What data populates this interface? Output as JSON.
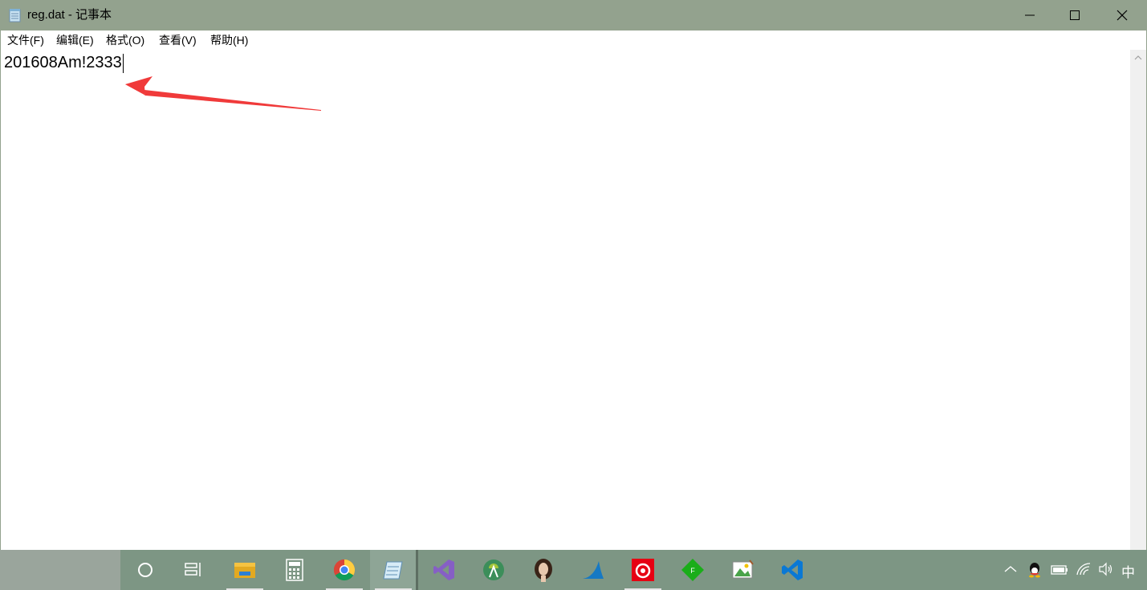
{
  "window": {
    "title": "reg.dat - 记事本",
    "minimize_icon": "minimize-icon",
    "maximize_icon": "maximize-icon",
    "close_icon": "close-icon"
  },
  "menu": {
    "items": [
      {
        "label": "文件(F)"
      },
      {
        "label": "编辑(E)"
      },
      {
        "label": "格式(O)"
      },
      {
        "label": "查看(V)"
      },
      {
        "label": "帮助(H)"
      }
    ]
  },
  "editor": {
    "content": "201608Am!2333"
  },
  "annotation": {
    "color": "#f03a3a"
  },
  "taskbar": {
    "icons": [
      "cortana-icon",
      "task-view-icon",
      "file-explorer-icon",
      "calculator-icon",
      "chrome-icon",
      "notepad-icon",
      "visual-studio-icon",
      "android-studio-icon",
      "portrait-app-icon",
      "wireshark-icon",
      "netease-music-icon",
      "green-diamond-app-icon",
      "image-editor-icon",
      "vscode-icon"
    ],
    "tray": {
      "ime_label": "中"
    }
  }
}
